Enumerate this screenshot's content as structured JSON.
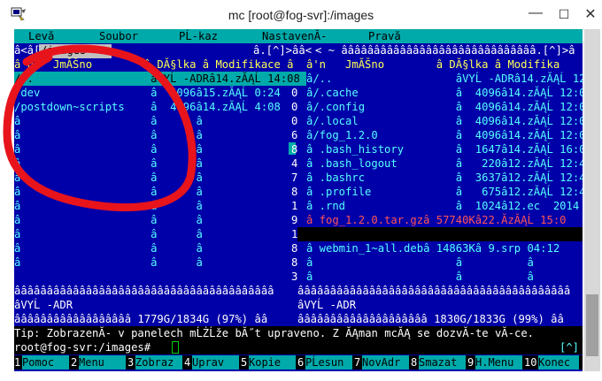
{
  "window": {
    "title": "mc [root@fog-svr]:/images"
  },
  "menu": [
    "Levă ",
    "Soubor",
    "PĹ-kaz",
    "NastavenĂ-",
    "Pravă "
  ],
  "left_panel": {
    "path_tab": "/images",
    "top_border": "â<â[",
    "top_right": "â.[^]>ââ<",
    "header": "â'n   JmĂŠno        â DĂ§lka â Modifikace â",
    "rows": [
      "/..                  âVYĹ -ADRâ14.zĂĄĹ 14:08",
      "/dev                 â  4096â15.zĂĄĹ 0:24",
      "/postdown~scripts    â  4096â14.zĂĄĹ 4:08",
      "â                    â      â",
      "â                    â      â",
      "â                    â      â",
      "â                    â      â",
      "â                    â      â",
      "â                    â      â",
      "â                    â      â",
      "â                    â      â",
      "â                    â      â",
      "â                    â      â",
      "â                    â      â"
    ],
    "sep": "ââââââââââââââââââââââââââââââââââââââââ",
    "info": "âVYĹ -ADR",
    "footer": "ââââââââââââââââââ 1779G/1834G (97%) ââ"
  },
  "right_panel": {
    "top_border": "< ~ ââââââââââââââââââââââââââââââ.[^]>â",
    "header": "â'n   JmĂŠno        â DĂ§lka â Modifika",
    "rows": [
      "â/..                   âVYĹ -ADRâ14.zĂĄĹ 12",
      "â/.cache               â  4096â14.zĂĄĹ 12:0",
      "â/.config              â  4096â14.zĂĄĹ 12:0",
      "â/.local               â  4096â14.zĂĄĹ 12:0",
      "â/fog_1.2.0            â  4096â14.zĂĄĹ 12:0",
      "â .bash_history        â  1647â14.zĂĄĹ 16:0",
      "â .bash_logout         â   220â12.zĂĄĹ 12:4",
      "â .bashrc              â  3637â12.zĂĄĹ 12:4",
      "â .profile             â   675â12.zĂĄĹ 12:4",
      "â .rnd                 â  1024â12.ec  2014",
      "â fog_1.2.0.tar.gzâ 57740Kâ22.ĂzĂĄĹ 15:0",
      "",
      "â webmin_1~all.debâ 14863Kâ 9.srp 04:12",
      "â                      â          â",
      "â                      â          â"
    ],
    "sep": "ââââââââââââââââââââââââââââââââââââââââââ",
    "info": "âVYĹ -ADR",
    "footer": "ââââââââââââââââââââ 1830G/1833G (99%) ââ"
  },
  "mid_digits": [
    "",
    "0",
    "0",
    "0",
    "6",
    "8",
    "4",
    "7",
    "8",
    "1",
    "9",
    "1",
    "8",
    "8",
    "3"
  ],
  "tip": "Tip: ZobrazenĂ- v panelech mĹŻĹže bĂ˝t upraveno. Z ĂĄman mcĂĄ se dozvĂ-te vĂ-ce.",
  "prompt": "root@fog-svr:/images# ",
  "prompt_right": "[^]",
  "fkeys": [
    {
      "num": "1",
      "label": "Pomoc"
    },
    {
      "num": "2",
      "label": "Menu"
    },
    {
      "num": "3",
      "label": "Zobraz"
    },
    {
      "num": "4",
      "label": "Uprav"
    },
    {
      "num": "5",
      "label": "Kopie"
    },
    {
      "num": "6",
      "label": "PĹesun"
    },
    {
      "num": "7",
      "label": "NovAdr"
    },
    {
      "num": "8",
      "label": "Smazat"
    },
    {
      "num": "9",
      "label": "H.Menu"
    },
    {
      "num": "10",
      "label": "Konec"
    }
  ],
  "colors": {
    "panel_bg": "#0000a8",
    "panel_fg": "#55ffff",
    "menu_bg": "#00aaaa",
    "annotation": "#e8141c"
  }
}
